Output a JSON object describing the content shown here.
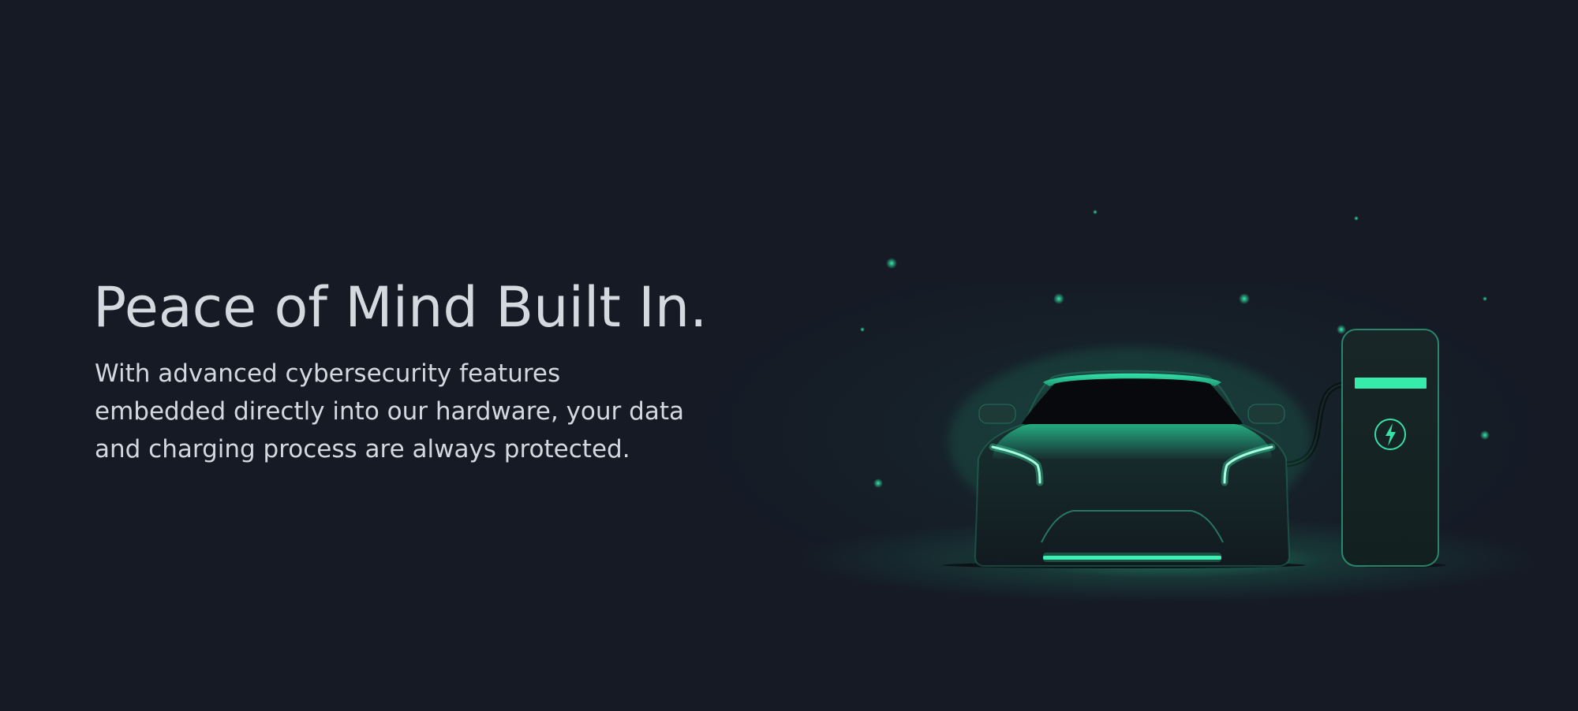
{
  "hero": {
    "headline": "Peace of Mind Built In.",
    "body": "With advanced cybersecurity features embedded directly into our hardware, your data and charging process are always protected."
  },
  "illustration": {
    "subject": "electric car at charging station",
    "icons": [
      "car-illustration",
      "charging-station-illustration",
      "lightning-bolt-icon"
    ]
  },
  "colors": {
    "background": "#151a25",
    "text": "#d5d8df",
    "accent_green": "#2ee6a6"
  }
}
